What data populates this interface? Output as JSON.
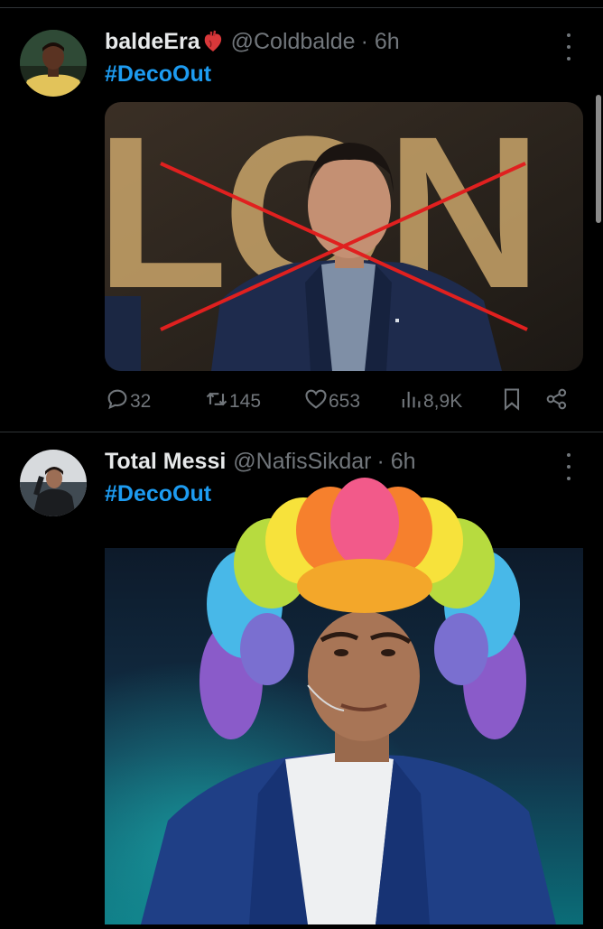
{
  "tweets": [
    {
      "author_name": "baldeEra",
      "author_handle": "@Coldbalde",
      "time": "· 6h",
      "hashtag": "#DecoOut",
      "stats": {
        "replies": "32",
        "reposts": "145",
        "likes": "653",
        "views": "8,9K"
      }
    },
    {
      "author_name": "Total Messi",
      "author_handle": "@NafisSikdar",
      "time": "· 6h",
      "hashtag": "#DecoOut"
    }
  ],
  "photo_backdrop_letters": "LON",
  "icons": [
    "more-icon",
    "reply-icon",
    "repost-icon",
    "like-icon",
    "views-icon",
    "bookmark-icon",
    "share-icon"
  ],
  "colors": {
    "background": "#000000",
    "hashtag": "#1d9bf0",
    "muted": "#71767b",
    "cross": "#e0201f",
    "divider": "#2f3336"
  }
}
